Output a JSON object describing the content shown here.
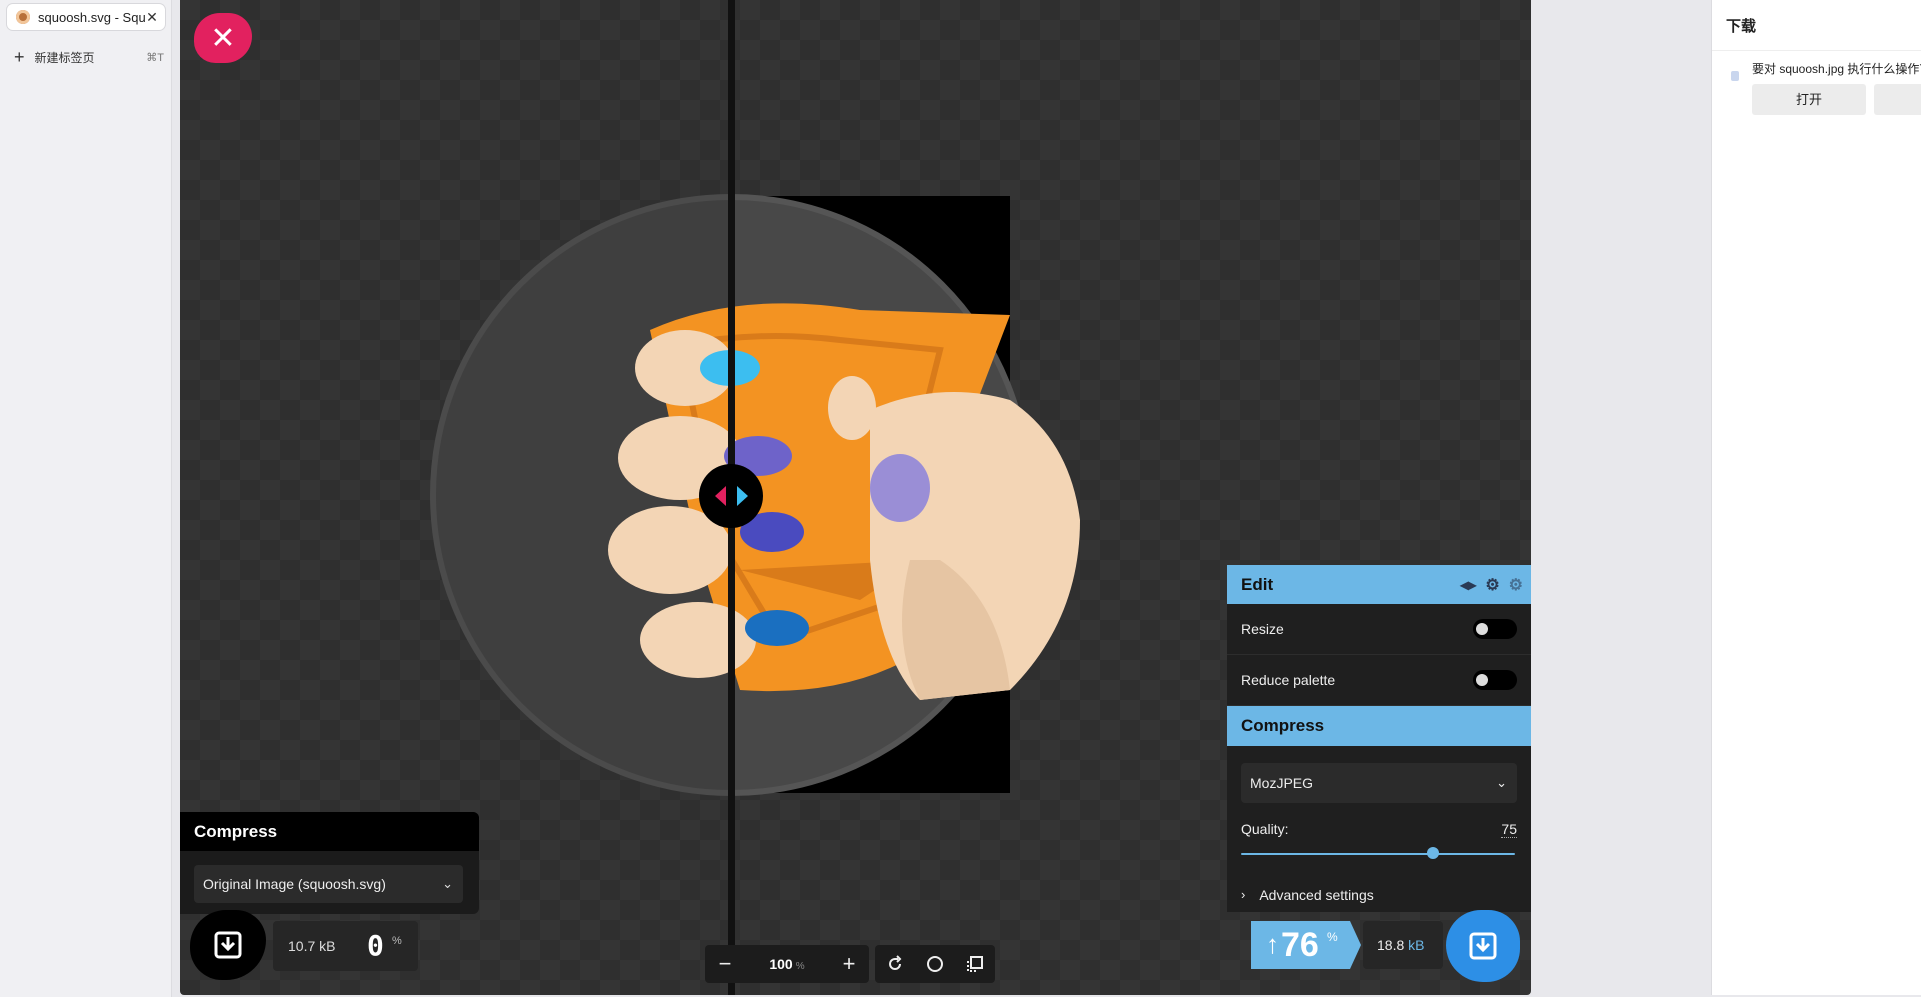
{
  "browser": {
    "tab_title": "squoosh.svg - Squoosh",
    "tab_close": "✕",
    "new_tab_label": "新建标签页",
    "new_tab_shortcut": "⌘T"
  },
  "left_panel": {
    "title": "Compress",
    "selected_option": "Original Image (squoosh.svg)",
    "file_size": "10.7 kB",
    "percent": "0",
    "percent_unit": "%"
  },
  "zoom": {
    "minus": "−",
    "value": "100",
    "unit": "%",
    "plus": "+"
  },
  "edit_panel": {
    "title": "Edit",
    "resize_label": "Resize",
    "reduce_palette_label": "Reduce palette",
    "compress_title": "Compress",
    "encoder": "MozJPEG",
    "quality_label": "Quality:",
    "quality_value": "75",
    "advanced_label": "Advanced settings"
  },
  "right_result": {
    "ratio_arrow": "↑",
    "ratio_value": "76",
    "ratio_unit": "%",
    "size_value": "18.8",
    "size_unit": "kB"
  },
  "downloads": {
    "title": "下载",
    "message": "要对 squoosh.jpg 执行什么操作？",
    "open_button": "打开"
  },
  "colors": {
    "accent_blue": "#6cb7e6",
    "close_pink": "#e2215f",
    "download_blue": "#2d8fe6"
  }
}
